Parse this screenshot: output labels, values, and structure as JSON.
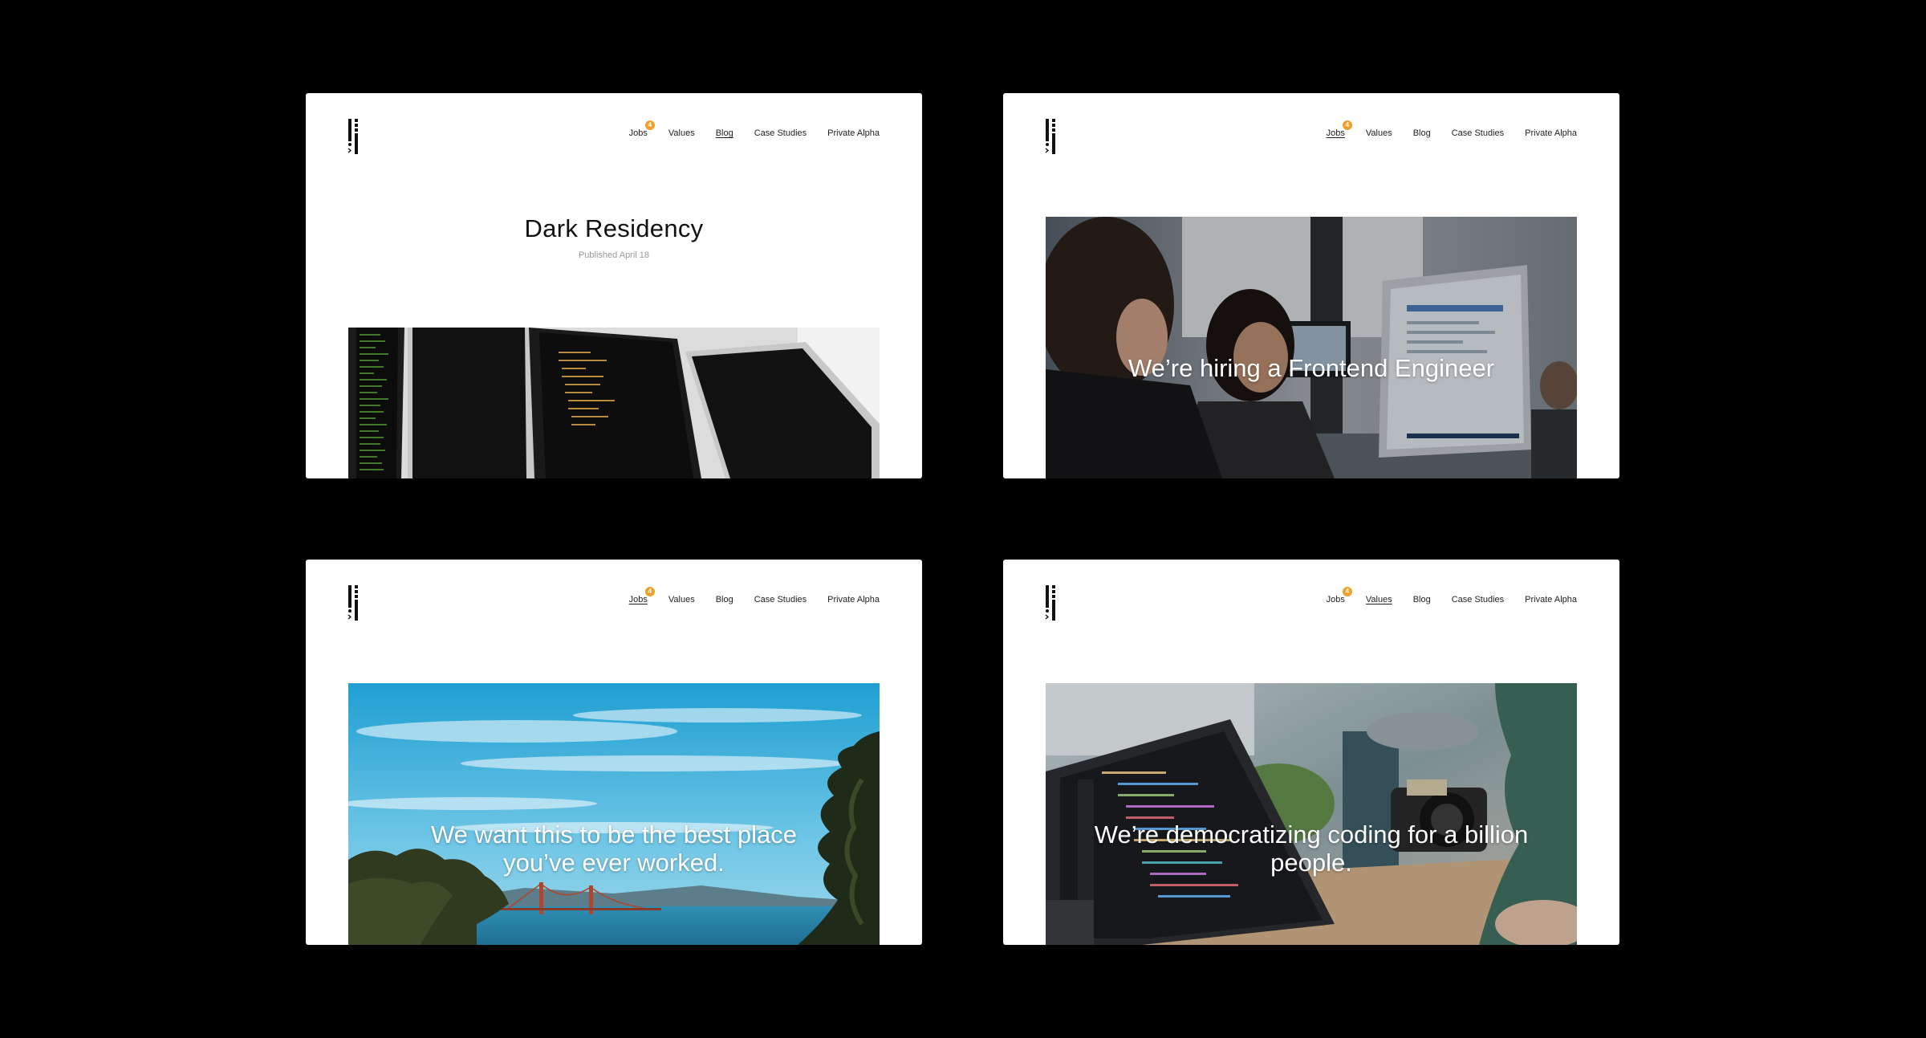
{
  "theme": {
    "accent": "#f0a12b",
    "text": "#222222",
    "muted": "#9a9a9a"
  },
  "logo": {
    "icon": "stacked-bars-logo-icon"
  },
  "nav": {
    "jobs": "Jobs",
    "jobs_badge": "4",
    "values": "Values",
    "blog": "Blog",
    "case_studies": "Case Studies",
    "private_alpha": "Private Alpha"
  },
  "screens": [
    {
      "active_nav": "Blog",
      "title": "Dark Residency",
      "published": "Published April 18",
      "image": "monitors-with-code"
    },
    {
      "active_nav": "Jobs",
      "headline": "We’re hiring a Frontend Engineer",
      "image": "people-at-computers"
    },
    {
      "active_nav": "Jobs",
      "headline": "We want this to be the best place you’ve ever worked.",
      "image": "golden-gate-bridge"
    },
    {
      "active_nav": "Values",
      "headline": "We’re democratizing coding for a billion people.",
      "image": "laptop-with-code"
    }
  ]
}
